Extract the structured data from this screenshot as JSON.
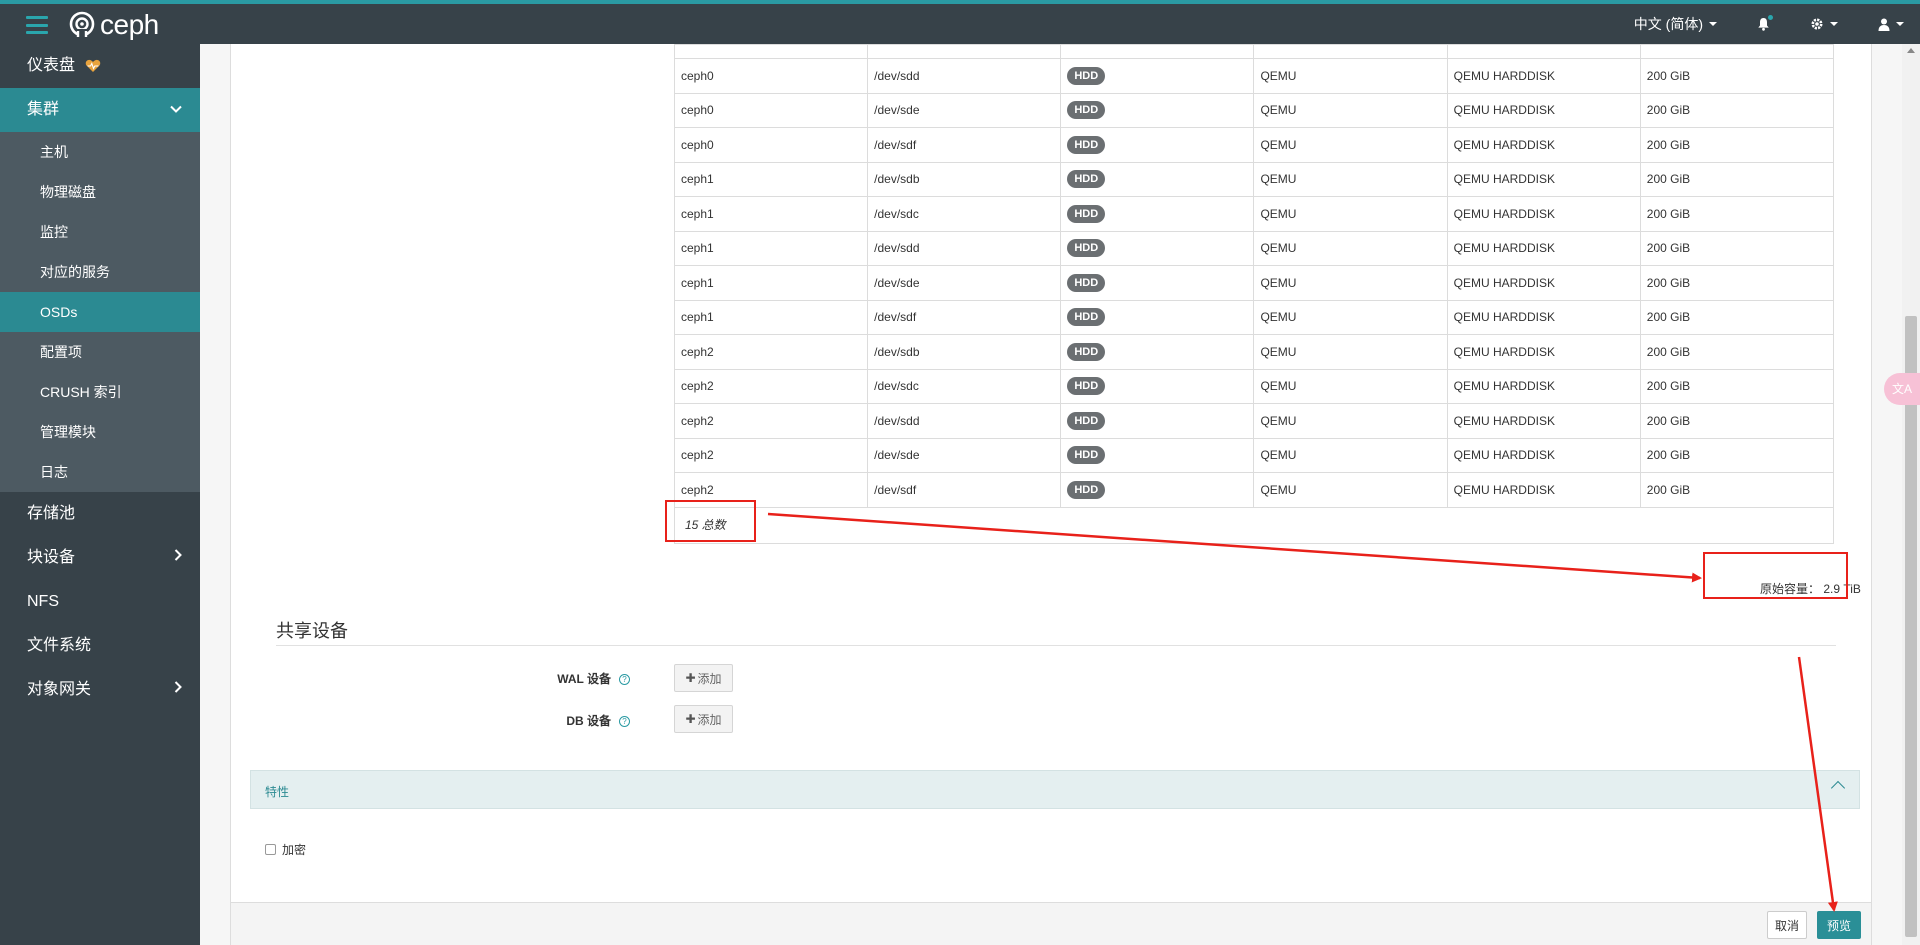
{
  "header": {
    "brand": "ceph",
    "language": "中文 (简体)"
  },
  "sidebar": {
    "top_items": [
      {
        "label": "仪表盘"
      },
      {
        "label": "集群"
      },
      {
        "label": "存储池"
      },
      {
        "label": "块设备"
      },
      {
        "label": "NFS"
      },
      {
        "label": "文件系统"
      },
      {
        "label": "对象网关"
      }
    ],
    "cluster_sub": [
      {
        "label": "主机"
      },
      {
        "label": "物理磁盘"
      },
      {
        "label": "监控"
      },
      {
        "label": "对应的服务"
      },
      {
        "label": "OSDs"
      },
      {
        "label": "配置项"
      },
      {
        "label": "CRUSH 索引"
      },
      {
        "label": "管理模块"
      },
      {
        "label": "日志"
      }
    ]
  },
  "devices": {
    "rows": [
      [
        "ceph0",
        "/dev/sdd",
        "HDD",
        "QEMU",
        "QEMU HARDDISK",
        "200 GiB"
      ],
      [
        "ceph0",
        "/dev/sde",
        "HDD",
        "QEMU",
        "QEMU HARDDISK",
        "200 GiB"
      ],
      [
        "ceph0",
        "/dev/sdf",
        "HDD",
        "QEMU",
        "QEMU HARDDISK",
        "200 GiB"
      ],
      [
        "ceph1",
        "/dev/sdb",
        "HDD",
        "QEMU",
        "QEMU HARDDISK",
        "200 GiB"
      ],
      [
        "ceph1",
        "/dev/sdc",
        "HDD",
        "QEMU",
        "QEMU HARDDISK",
        "200 GiB"
      ],
      [
        "ceph1",
        "/dev/sdd",
        "HDD",
        "QEMU",
        "QEMU HARDDISK",
        "200 GiB"
      ],
      [
        "ceph1",
        "/dev/sde",
        "HDD",
        "QEMU",
        "QEMU HARDDISK",
        "200 GiB"
      ],
      [
        "ceph1",
        "/dev/sdf",
        "HDD",
        "QEMU",
        "QEMU HARDDISK",
        "200 GiB"
      ],
      [
        "ceph2",
        "/dev/sdb",
        "HDD",
        "QEMU",
        "QEMU HARDDISK",
        "200 GiB"
      ],
      [
        "ceph2",
        "/dev/sdc",
        "HDD",
        "QEMU",
        "QEMU HARDDISK",
        "200 GiB"
      ],
      [
        "ceph2",
        "/dev/sdd",
        "HDD",
        "QEMU",
        "QEMU HARDDISK",
        "200 GiB"
      ],
      [
        "ceph2",
        "/dev/sde",
        "HDD",
        "QEMU",
        "QEMU HARDDISK",
        "200 GiB"
      ],
      [
        "ceph2",
        "/dev/sdf",
        "HDD",
        "QEMU",
        "QEMU HARDDISK",
        "200 GiB"
      ]
    ],
    "total": "15 总数",
    "raw_capacity": "原始容量： 2.9 TiB"
  },
  "shared": {
    "title": "共享设备",
    "wal_label": "WAL 设备",
    "db_label": "DB 设备",
    "add_label": "添加"
  },
  "features": {
    "title": "特性",
    "encrypt_label": "加密"
  },
  "footer": {
    "cancel": "取消",
    "preview": "预览"
  },
  "float_tool": "文A",
  "colors": {
    "accent": "#2b8a92",
    "topbar": "#374249",
    "sidebar_sub": "#4d5a62",
    "annotation": "#e8211a"
  }
}
